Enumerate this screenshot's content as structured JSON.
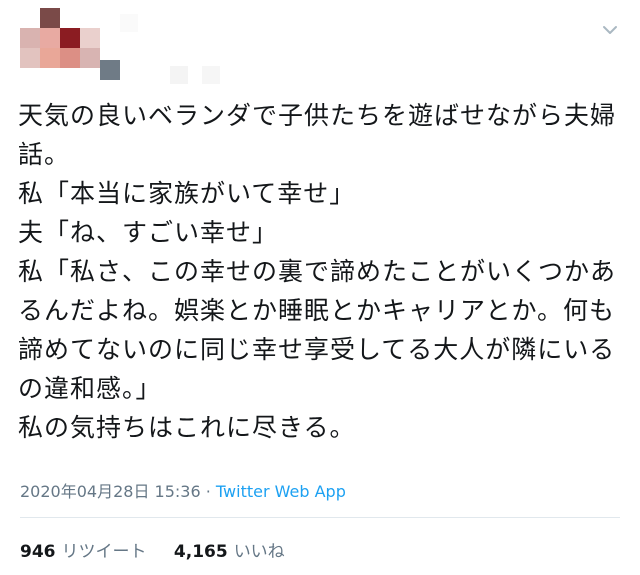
{
  "tweet": {
    "text": "天気の良いベランダで子供たちを遊ばせながら夫婦話。\n私「本当に家族がいて幸せ」\n夫「ね、すごい幸せ」\n私「私さ、この幸せの裏で諦めたことがいくつかあるんだよね。娯楽とか睡眠とかキャリアとか。何も諦めてないのに同じ幸せ享受してる大人が隣にいるの違和感。」\n私の気持ちはこれに尽きる。",
    "timestamp": "2020年04月28日 15:36",
    "separator": " · ",
    "source": "Twitter Web App"
  },
  "stats": {
    "retweets_count": "946",
    "retweets_label": "リツイート",
    "likes_count": "4,165",
    "likes_label": "いいね"
  },
  "icons": {
    "menu": "chevron-down-icon"
  },
  "colors": {
    "link": "#1da1f2",
    "muted": "#657786",
    "text": "#14171a",
    "divider": "#e1e8ed"
  }
}
